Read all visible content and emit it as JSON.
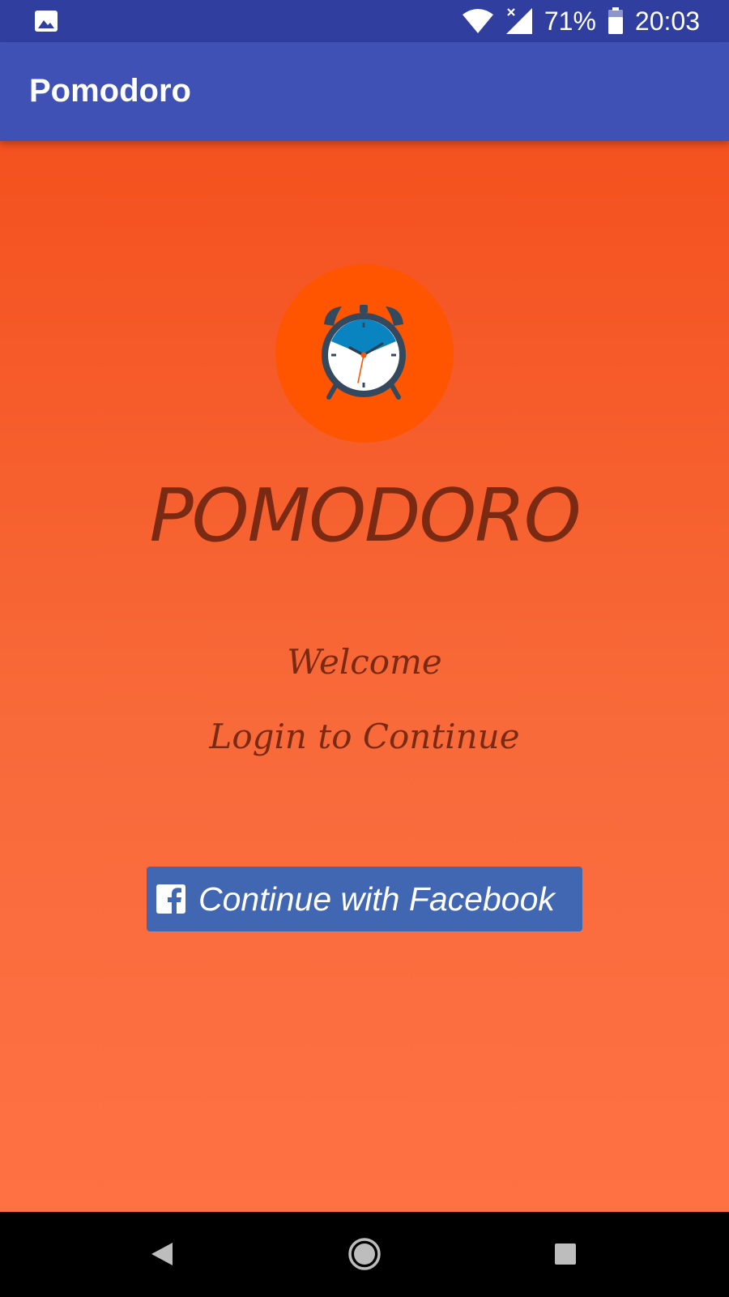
{
  "status_bar": {
    "left_icon": "image-icon",
    "battery": "71%",
    "time": "20:03",
    "icons": [
      "wifi-icon",
      "signal-icon",
      "battery-icon"
    ]
  },
  "app_bar": {
    "title": "Pomodoro"
  },
  "main": {
    "logo_icon": "alarm-clock-icon",
    "headline": "POMODORO",
    "welcome": "Welcome",
    "login_message": "Login to Continue",
    "facebook_button": {
      "icon": "facebook-icon",
      "label": "Continue with Facebook"
    }
  },
  "nav_bar": {
    "buttons": [
      "back-icon",
      "home-icon",
      "recents-icon"
    ]
  },
  "colors": {
    "status_bar": "#303F9F",
    "app_bar": "#3F51B5",
    "background_top": "#F4511E",
    "background_bottom": "#FF7043",
    "logo_circle": "#FF5500",
    "text": "#7A2A12",
    "facebook_button": "#4267B2"
  }
}
